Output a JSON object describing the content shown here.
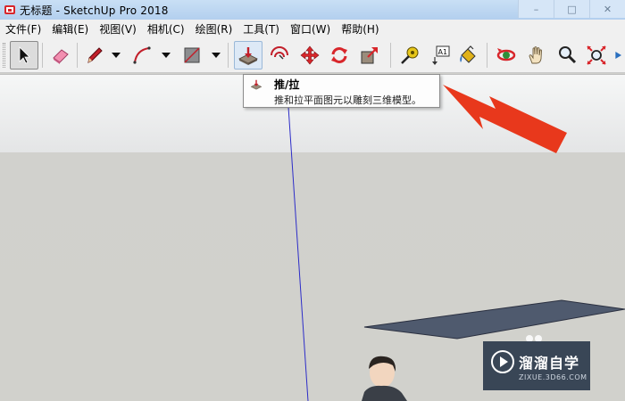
{
  "window": {
    "title": "无标题 - SketchUp Pro 2018",
    "controls": [
      "–",
      "□",
      "✕"
    ]
  },
  "menu": [
    {
      "label": "文件(F)"
    },
    {
      "label": "编辑(E)"
    },
    {
      "label": "视图(V)"
    },
    {
      "label": "相机(C)"
    },
    {
      "label": "绘图(R)"
    },
    {
      "label": "工具(T)"
    },
    {
      "label": "窗口(W)"
    },
    {
      "label": "帮助(H)"
    }
  ],
  "toolbar": {
    "tools": [
      {
        "name": "select-tool",
        "icon": "arrow-cursor-icon",
        "state": "active"
      },
      {
        "name": "eraser-tool",
        "icon": "eraser-icon"
      },
      {
        "name": "line-tool",
        "icon": "pencil-icon"
      },
      {
        "name": "arc-tool",
        "icon": "arc-icon"
      },
      {
        "name": "shape-tool",
        "icon": "rectangle-icon"
      },
      {
        "name": "push-pull-tool",
        "icon": "push-pull-icon",
        "state": "hover"
      },
      {
        "name": "offset-tool",
        "icon": "offset-icon"
      },
      {
        "name": "move-tool",
        "icon": "move-arrows-icon"
      },
      {
        "name": "rotate-tool",
        "icon": "rotate-icon"
      },
      {
        "name": "scale-tool",
        "icon": "scale-icon"
      },
      {
        "name": "tape-measure-tool",
        "icon": "tape-measure-icon"
      },
      {
        "name": "text-tool",
        "icon": "text-label-icon",
        "label": "A1"
      },
      {
        "name": "paint-bucket-tool",
        "icon": "paint-bucket-icon"
      },
      {
        "name": "orbit-tool",
        "icon": "orbit-icon"
      },
      {
        "name": "pan-tool",
        "icon": "hand-icon"
      },
      {
        "name": "zoom-tool",
        "icon": "magnifier-icon"
      },
      {
        "name": "zoom-extents-tool",
        "icon": "zoom-extents-icon"
      },
      {
        "name": "more-tool",
        "icon": "overflow-icon"
      }
    ]
  },
  "tooltip": {
    "title": "推/拉",
    "description": "推和拉平面图元以雕刻三维模型。"
  },
  "watermark": {
    "name": "溜溜自学",
    "url": "ZIXUE.3D66.COM"
  },
  "colors": {
    "arrow": "#e8381c",
    "axis_blue": "#2d2dc8",
    "plane_fill": "#4f5a6e"
  }
}
